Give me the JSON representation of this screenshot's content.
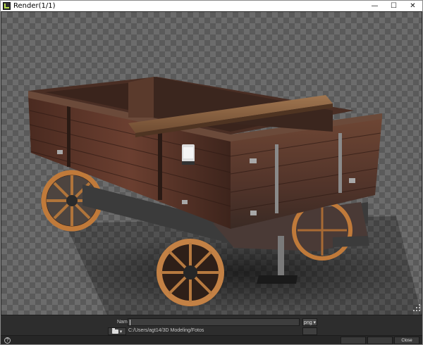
{
  "window": {
    "title": "Render(1/1)",
    "controls": {
      "minimize": "—",
      "maximize": "☐",
      "close": "✕"
    }
  },
  "output": {
    "name_label": "Name",
    "name_value": "",
    "extension": "png ▾",
    "folder_dropdown": "▾",
    "path": "C:/Users/agt14/3D Modeling/Fotos"
  },
  "footer": {
    "help": "?",
    "buttons": [
      "",
      "",
      "Close"
    ]
  },
  "colors": {
    "background": "#2b2b2b",
    "checker_light": "#6c6c6c",
    "checker_dark": "#5a5a5a"
  }
}
